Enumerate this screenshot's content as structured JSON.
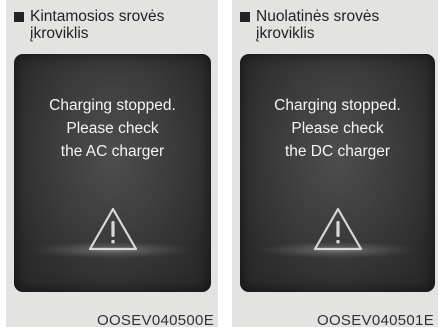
{
  "panels": [
    {
      "heading_line1": "Kintamosios srovės",
      "heading_line2": "įkroviklis",
      "message_line1": "Charging stopped.",
      "message_line2": "Please check",
      "message_line3": "the AC charger",
      "code": "OOSEV040500E"
    },
    {
      "heading_line1": "Nuolatinės srovės",
      "heading_line2": "įkroviklis",
      "message_line1": "Charging stopped.",
      "message_line2": "Please check",
      "message_line3": "the DC charger",
      "code": "OOSEV040501E"
    }
  ],
  "icons": {
    "bullet": "square-bullet-icon",
    "warning": "warning-triangle-icon"
  },
  "colors": {
    "panel_background": "#e3e3e1",
    "screen_background": "#333333",
    "screen_text": "#f4f4f4"
  }
}
